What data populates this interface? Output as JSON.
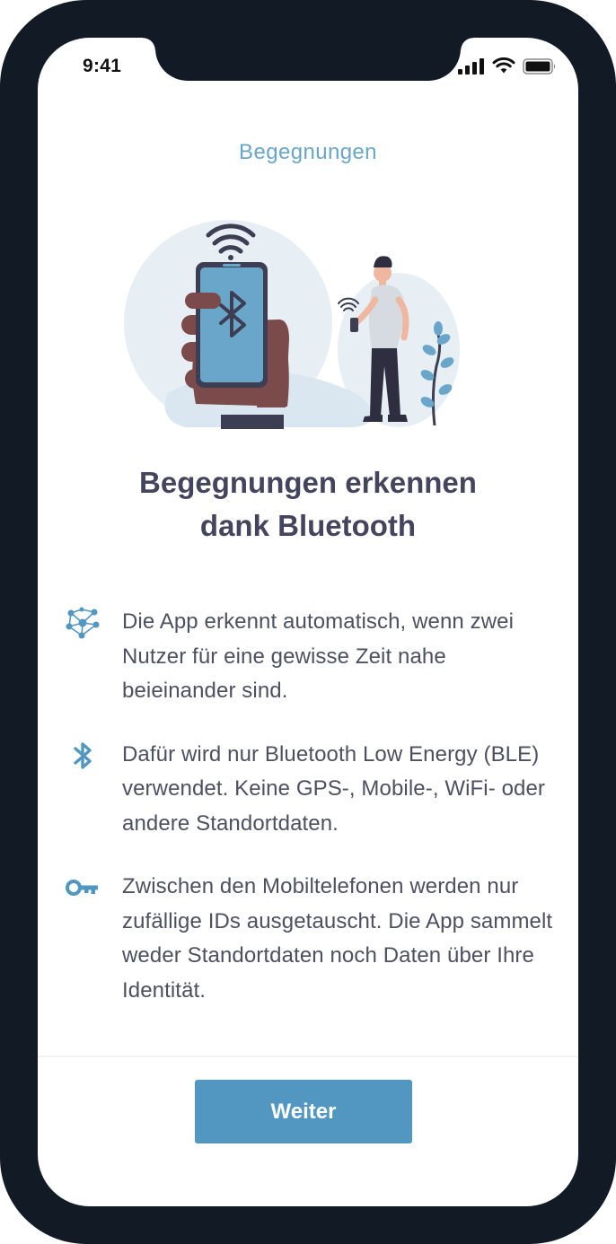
{
  "status_bar": {
    "time": "9:41"
  },
  "nav": {
    "title": "Begegnungen"
  },
  "headline": {
    "line1": "Begegnungen erkennen",
    "line2": "dank Bluetooth"
  },
  "features": [
    {
      "icon": "network-icon",
      "text": "Die App erkennt automatisch, wenn zwei Nutzer für eine gewisse Zeit nahe beieinander sind."
    },
    {
      "icon": "bluetooth-icon",
      "text": "Dafür wird nur Bluetooth Low Energy (BLE) verwendet. Keine GPS-, Mobile-, WiFi- oder andere Standortdaten."
    },
    {
      "icon": "key-icon",
      "text": "Zwischen den Mobiltelefonen werden nur zufällige IDs ausgetauscht. Die App sammelt weder Standortdaten noch Daten über Ihre Identität."
    }
  ],
  "footer": {
    "button_label": "Weiter"
  },
  "colors": {
    "device_frame": "#121a26",
    "accent_blue": "#5297c2",
    "title_blue": "#6aa6c9",
    "headline_text": "#45445f",
    "body_text": "#4d5061",
    "illustration_bg": "#e7eff5"
  }
}
